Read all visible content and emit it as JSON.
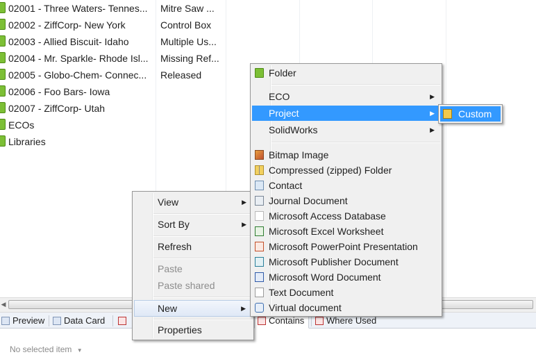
{
  "rows": [
    {
      "name": "02001 - Three Waters- Tennes...",
      "desc": "Mitre Saw ..."
    },
    {
      "name": "02002 - ZiffCorp- New York",
      "desc": "Control Box"
    },
    {
      "name": "02003 - Allied Biscuit- Idaho",
      "desc": "Multiple Us..."
    },
    {
      "name": "02004 - Mr. Sparkle- Rhode Isl...",
      "desc": "Missing Ref..."
    },
    {
      "name": "02005 - Globo-Chem- Connec...",
      "desc": "Released"
    },
    {
      "name": "02006 - Foo Bars- Iowa",
      "desc": ""
    },
    {
      "name": "02007 - ZiffCorp- Utah",
      "desc": ""
    },
    {
      "name": "ECOs",
      "desc": ""
    },
    {
      "name": "Libraries",
      "desc": ""
    }
  ],
  "context_menu": {
    "view": "View",
    "sort_by": "Sort By",
    "refresh": "Refresh",
    "paste": "Paste",
    "paste_shared": "Paste shared",
    "new": "New",
    "properties": "Properties"
  },
  "new_menu": {
    "folder": "Folder",
    "eco": "ECO",
    "project": "Project",
    "solidworks": "SolidWorks",
    "bitmap": "Bitmap Image",
    "zip": "Compressed (zipped) Folder",
    "contact": "Contact",
    "journal": "Journal Document",
    "access": "Microsoft Access Database",
    "excel": "Microsoft Excel Worksheet",
    "powerpoint": "Microsoft PowerPoint Presentation",
    "publisher": "Microsoft Publisher Document",
    "word": "Microsoft Word Document",
    "text": "Text Document",
    "virtual": "Virtual document"
  },
  "project_menu": {
    "custom": "Custom"
  },
  "tabs": {
    "preview": "Preview",
    "data_card": "Data Card",
    "contains": "Contains",
    "where_used": "Where Used"
  },
  "status": {
    "no_selected": "No selected item"
  },
  "colors": {
    "highlight": "#3399ff",
    "folder_green": "#7cbf35"
  }
}
